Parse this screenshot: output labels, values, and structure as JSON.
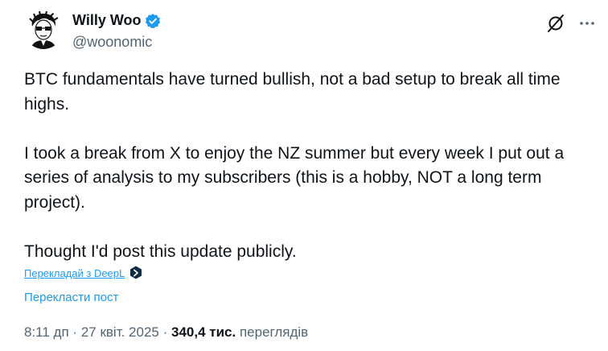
{
  "author": {
    "display_name": "Willy Woo",
    "handle": "@woonomic",
    "verified": true,
    "verified_color": "#1d9bf0"
  },
  "tweet": {
    "paragraphs": [
      "BTC fundamentals have turned bullish, not a bad setup to break all time highs.",
      "I took a break from X to enjoy the NZ summer but every week I put out a series of analysis to my subscribers (this is a hobby, NOT a long term project).",
      "Thought I'd post this update publicly."
    ]
  },
  "translate": {
    "deepl_label": "Перекладай з DeepL",
    "deepl_icon": "deepl-icon",
    "post_label": "Перекласти пост"
  },
  "meta": {
    "time": "8:11 дп",
    "separator1": "·",
    "date": "27 квіт. 2025",
    "separator2": "·",
    "views_count": "340,4 тис.",
    "views_label": "переглядів"
  },
  "icons": {
    "grok": "grok-icon",
    "more": "more-options-icon"
  },
  "colors": {
    "text_primary": "#0f1419",
    "text_secondary": "#536471",
    "accent": "#1d9bf0"
  }
}
